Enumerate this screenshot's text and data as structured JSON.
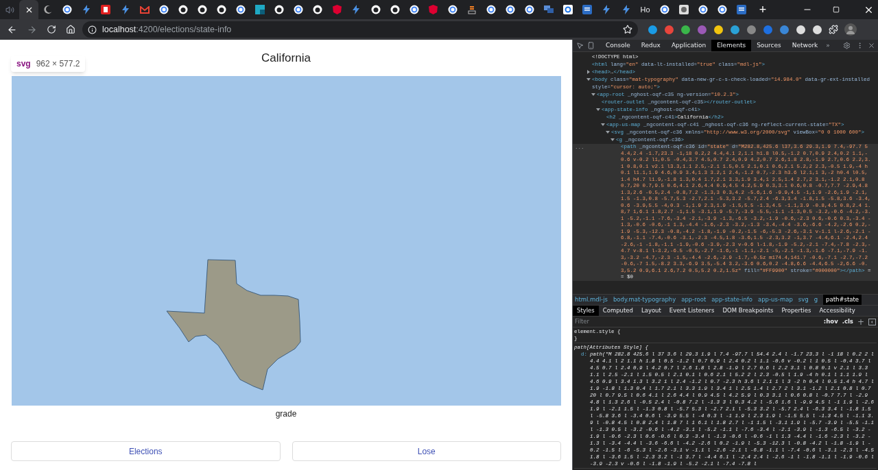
{
  "browser": {
    "tabs": [
      {
        "selected": false
      },
      {
        "selected": true
      },
      {
        "selected": false
      },
      {
        "selected": false
      },
      {
        "selected": false
      },
      {
        "selected": false
      },
      {
        "selected": false
      },
      {
        "selected": false
      },
      {
        "selected": false
      },
      {
        "selected": false
      },
      {
        "selected": false
      },
      {
        "selected": false
      },
      {
        "selected": false
      },
      {
        "selected": false
      },
      {
        "selected": false
      },
      {
        "selected": false
      },
      {
        "selected": false
      },
      {
        "selected": false
      },
      {
        "selected": false
      },
      {
        "selected": false
      },
      {
        "selected": false
      },
      {
        "selected": false
      },
      {
        "selected": false
      },
      {
        "selected": false
      },
      {
        "selected": false
      },
      {
        "selected": false
      },
      {
        "selected": false
      },
      {
        "selected": false
      },
      {
        "selected": false
      },
      {
        "selected": false
      },
      {
        "selected": false
      },
      {
        "selected": false
      },
      {
        "selected": false
      },
      {
        "selected": false,
        "label": "Ho"
      },
      {
        "selected": false
      },
      {
        "selected": false
      },
      {
        "selected": false
      },
      {
        "selected": false
      },
      {
        "selected": false
      }
    ],
    "new_tab": "+",
    "address": {
      "host": "localhost",
      "path": ":4200/elections/state-info"
    }
  },
  "page": {
    "title": "California",
    "tooltip": {
      "tag": "svg",
      "size": "962 × 577.2"
    },
    "caption": "grade",
    "buttons": [
      "Elections",
      "Lose"
    ]
  },
  "devtools": {
    "tabs": [
      {
        "label": "Console",
        "selected": false
      },
      {
        "label": "Redux",
        "selected": false
      },
      {
        "label": "Application",
        "selected": false
      },
      {
        "label": "Elements",
        "selected": true
      },
      {
        "label": "Sources",
        "selected": false
      },
      {
        "label": "Network",
        "selected": false
      }
    ],
    "more": "»",
    "dom": [
      {
        "selected": false,
        "parts": [
          {
            "kind": "text",
            "text": "<!DOCTYPE html>"
          }
        ]
      },
      {
        "selected": false,
        "parts": [
          {
            "kind": "tag",
            "text": "<html"
          },
          {
            "kind": "attr",
            "text": " lang="
          },
          {
            "kind": "val",
            "text": "\"en\""
          },
          {
            "kind": "attr",
            "text": " data-lt-installed="
          },
          {
            "kind": "val",
            "text": "\"true\""
          },
          {
            "kind": "attr",
            "text": " class="
          },
          {
            "kind": "val",
            "text": "\"mdl-js\""
          },
          {
            "kind": "tag",
            "text": ">"
          }
        ]
      },
      {
        "expanded": false,
        "selected": false,
        "parts": [
          {
            "kind": "tag",
            "text": "<head>"
          },
          {
            "kind": "text",
            "text": "…"
          },
          {
            "kind": "tag",
            "text": "</head>"
          }
        ]
      },
      {
        "expanded": true,
        "selected": false,
        "parts": [
          {
            "kind": "tag",
            "text": "<body"
          },
          {
            "kind": "attr",
            "text": " class="
          },
          {
            "kind": "val",
            "text": "\"mat-typography\""
          },
          {
            "kind": "attr",
            "text": " data-new-gr-c-s-check-loaded="
          },
          {
            "kind": "val",
            "text": "\"14.984.0\""
          },
          {
            "kind": "attr",
            "text": " data-gr-ext-installed style="
          },
          {
            "kind": "val",
            "text": "\"cursor: auto;\""
          },
          {
            "kind": "tag",
            "text": ">"
          }
        ],
        "children": [
          {
            "expanded": true,
            "selected": false,
            "parts": [
              {
                "kind": "tag",
                "text": "<app-root"
              },
              {
                "kind": "attr",
                "text": " _nghost-oqf-c35 ng-version="
              },
              {
                "kind": "val",
                "text": "\"10.2.3\""
              },
              {
                "kind": "tag",
                "text": ">"
              }
            ],
            "children": [
              {
                "selected": false,
                "parts": [
                  {
                    "kind": "tag",
                    "text": "<router-outlet"
                  },
                  {
                    "kind": "attr",
                    "text": " _ngcontent-oqf-c35"
                  },
                  {
                    "kind": "tag",
                    "text": "></router-outlet>"
                  }
                ]
              },
              {
                "expanded": true,
                "selected": false,
                "parts": [
                  {
                    "kind": "tag",
                    "text": "<app-state-info"
                  },
                  {
                    "kind": "attr",
                    "text": " _nghost-oqf-c41"
                  },
                  {
                    "kind": "tag",
                    "text": ">"
                  }
                ],
                "children": [
                  {
                    "selected": false,
                    "parts": [
                      {
                        "kind": "tag",
                        "text": "<h2"
                      },
                      {
                        "kind": "attr",
                        "text": " _ngcontent-oqf-c41"
                      },
                      {
                        "kind": "tag",
                        "text": ">"
                      },
                      {
                        "kind": "text",
                        "text": "California"
                      },
                      {
                        "kind": "tag",
                        "text": "</h2>"
                      }
                    ]
                  },
                  {
                    "expanded": true,
                    "selected": false,
                    "parts": [
                      {
                        "kind": "tag",
                        "text": "<app-us-map"
                      },
                      {
                        "kind": "attr",
                        "text": " _ngcontent-oqf-c41 _nghost-oqf-c36 ng-reflect-current-state="
                      },
                      {
                        "kind": "val",
                        "text": "\"TX\""
                      },
                      {
                        "kind": "tag",
                        "text": ">"
                      }
                    ],
                    "children": [
                      {
                        "expanded": true,
                        "selected": false,
                        "parts": [
                          {
                            "kind": "tag",
                            "text": "<svg"
                          },
                          {
                            "kind": "attr",
                            "text": " _ngcontent-oqf-c36 xmlns="
                          },
                          {
                            "kind": "val",
                            "text": "\"http://www.w3.org/2000/svg\""
                          },
                          {
                            "kind": "attr",
                            "text": " viewBox="
                          },
                          {
                            "kind": "val",
                            "text": "\"0 0 1000 600\""
                          },
                          {
                            "kind": "tag",
                            "text": ">"
                          }
                        ],
                        "children": [
                          {
                            "expanded": true,
                            "selected": false,
                            "parts": [
                              {
                                "kind": "tag",
                                "text": "<g"
                              },
                              {
                                "kind": "attr",
                                "text": " _ngcontent-oqf-c36"
                              },
                              {
                                "kind": "tag",
                                "text": ">"
                              }
                            ],
                            "children": [
                              {
                                "selected": true,
                                "gutter": "...",
                                "parts": [
                                  {
                                    "kind": "tag",
                                    "text": "<path"
                                  },
                                  {
                                    "kind": "attr",
                                    "text": " _ngcontent-oqf-c36 id="
                                  },
                                  {
                                    "kind": "val",
                                    "text": "\"state\""
                                  },
                                  {
                                    "kind": "attr",
                                    "text": " d="
                                  },
                                  {
                                    "kind": "val",
                                    "text": "\"M282.8,425.6 l37,3.6 29.3,1.9 7.4,-97.7 54.4,2.4 -1.7,23.3 -1,18 0.2,2 4.4,4.1 2,1.1 h1.8 l0.5,-1.2 0.7,0.9 2.4,0.2 1.1,-0.6 v-0.2 l1,0.5 -0.4,3.7 4.5,0.7 2.4,0.9 4.2,0.7 2.6,1.8 2.8,-1.9 2.7,0.6 2.2,3.1 0.8,0.1 v2.1 l3.3,1.1 2.5,-2.1 1.5,0.5 2.1,0.1 0.6,2.1 5.2,2 2.3,-0.5 1.9,-4 h0.1 l1.1,1.9 4.6,0.9 3.4,1.3 3.2,1 2.4,-1.2 0.7,-2.3 h3.6 l2.1,1 3,-2 h0.4 l0.5,1.4 h4.7 l1.9,-1.8 1.3,0.4 1.7,2.1 3.3,1.9 3.4,1 2.5,1.4 2.7,2 3.1,-1.2 2.1,0.8 0.7,20 0.7,9.5 0.6,4.1 2.6,4.4 0.9,4.5 4.2,5.9 0.3,3.1 0.6,0.8 -0.7,7.7 -2.9,4.8 1.3,2.6 -0.5,2.4 -0.8,7.2 -1.3,3 0.3,4.2 -5.6,1.6 -9.9,4.5 -1,1.9 -2.6,1.9 -2.1,1.5 -1.3,0.8 -5.7,5.3 -2.7,2.1 -5.3,3.2 -5.7,2.4 -6.3,3.4 -1.8,1.5 -5.8,3.6 -3.4,0.6 -3.9,5.5 -4,0.3 -1,1.9 2.3,1.9 -1.5,5.5 -1.3,4.5 -1.1,3.9 -0.8,4.5 0.8,2.4 1.8,7 1,6.1 1.8,2.7 -1,1.5 -3.1,1.9 -5.7,-3.9 -5.5,-1.1 -1.3,0.5 -3.2,-0.6 -4.2,-3.1 -5.2,-1.1 -7.6,-3.4 -2.1,-3.9 -1.3,-6.5 -3.2,-1.9 -0.6,-2.3 0.6,-0.6 0.3,-3.4 -1.3,-0.6 -0.6,-1 1.3,-4.4 -1.6,-2.3 -3.2,-1.3 -3.4,-4.4 -3.6,-6.6 -4.2,-2.6 0.2,-1.9 -5.3,-12.3 -0.8,-4.2 -1.8,-1.9 -0.2,-1.5 -6,-5.3 -2.6,-3.1 v-1.1 l-2.6,-2.1 -6.8,-1.1 -7.4,-0.6 -3.1,-2.3 -4.5,1.8 -3.6,1.5 -2.3,3.2 -1,3.7 -4.4,6.1 -2.4,2.4 -2.6,-1 -1.8,-1.1 -1.9,-0.6 -3.9,-2.3 v-0.6 l-1.8,-1.9 -5.2,-2.1 -7.4,-7.8 -2.3,-4.7 v-8.1 l-3.2,-6.5 -0.5,-2.7 -1.6,-1 -1.1,-2.1 -5,-2.1 -1.3,-1.6 -7.1,-7.9 -1.3,-3.2 -4.7,-2.3 -1.5,-4.4 -2.6,-2.9 -1.7,-0.5z m174.4,141.7 -0.6,-7.1 -2.7,-7.2 -0.6,-7 1.5,-8.2 3.3,-6.9 3.5,-5.4 3.2,-3.6 0.6,0.2 -4.8,6.6 -4.4,6.5 -2,6.6 -0.3,5.2 0.9,6.1 2.6,7.2 0.5,5.2 0.2,1.5z\""
                                  },
                                  {
                                    "kind": "attr",
                                    "text": " fill="
                                  },
                                  {
                                    "kind": "val",
                                    "text": "\"#FF9900\""
                                  },
                                  {
                                    "kind": "attr",
                                    "text": " stroke="
                                  },
                                  {
                                    "kind": "val",
                                    "text": "\"#000000\""
                                  },
                                  {
                                    "kind": "tag",
                                    "text": "></path>"
                                  },
                                  {
                                    "kind": "text",
                                    "text": " == $0"
                                  }
                                ]
                              }
                            ]
                          }
                        ]
                      }
                    ]
                  }
                ]
              }
            ]
          }
        ]
      }
    ],
    "breadcrumbs": [
      {
        "label": "html.mdl-js",
        "selected": false
      },
      {
        "label": "body.mat-typography",
        "selected": false
      },
      {
        "label": "app-root",
        "selected": false
      },
      {
        "label": "app-state-info",
        "selected": false
      },
      {
        "label": "app-us-map",
        "selected": false
      },
      {
        "label": "svg",
        "selected": false
      },
      {
        "label": "g",
        "selected": false
      },
      {
        "label": "path#state",
        "selected": true
      }
    ],
    "style_tabs": [
      {
        "label": "Styles",
        "selected": true
      },
      {
        "label": "Computed",
        "selected": false
      },
      {
        "label": "Layout",
        "selected": false
      },
      {
        "label": "Event Listeners",
        "selected": false
      },
      {
        "label": "DOM Breakpoints",
        "selected": false
      },
      {
        "label": "Properties",
        "selected": false
      },
      {
        "label": "Accessibility",
        "selected": false
      }
    ],
    "filter": {
      "placeholder": "Filter",
      "hov": ":hov",
      "cls": ".cls",
      "add": "+"
    },
    "rules": [
      {
        "selector": "element.style {",
        "close": "}"
      },
      {
        "selector": "path[Attributes Style] {",
        "property": "d:",
        "value": "path(\"M 282.8 425.6 l 37 3.6 l 29.3 1.9 l 7.4 -97.7 l 54.4 2.4 l -1.7 23.3 l -1 18 l 0.2 2 l 4.4 4.1 l 2 1.1 h 1.8 l 0.5 -1.2 l 0.7 0.9 l 2.4 0.2 l 1.1 -0.6 v -0.2 l 1 0.5 l -0.4 3.7 l 4.5 0.7 l 2.4 0.9 l 4.2 0.7 l 2.6 1.8 l 2.8 -1.9 l 2.7 0.6 l 2.2 3.1 l 0.8 0.1 v 2.1 l 3.3 1.1 l 2.5 -2.1 l 1.5 0.5 l 2.1 0.1 l 0.6 2.1 l 5.2 2 l 2.3 -0.5 l 1.9 -4 h 0.1 l 1.1 1.9 l 4.6 0.9 l 3.4 1.3 l 3.2 1 l 2.4 -1.2 l 0.7 -2.3 h 3.6 l 2.1 1 l 3 -2 h 0.4 l 0.5 1.4 h 4.7 l 1.9 -1.8 l 1.3 0.4 l 1.7 2.1 l 3.3 1.9 l 3.4 1 l 2.5 1.4 l 2.7 2 l 3.1 -1.2 l 2.1 0.8 l 0.7 20 l 0.7 9.5 l 0.6 4.1 l 2.6 4.4 l 0.9 4.5 l 4.2 5.9 l 0.3 3.1 l 0.6 0.8 l -0.7 7.7 l -2.9 4.8 l 1.3 2.6 l -0.5 2.4 l -0.8 7.2 l -1.3 3 l 0.3 4.2 l -5.6 1.6 l -9.9 4.5 l -1 1.9 l -2.6 1.9 l -2.1 1.5 l -1.3 0.8 l -5.7 5.3 l -2.7 2.1 l -5.3 3.2 l -5.7 2.4 l -6.3 3.4 l -1.8 1.5 l -5.8 3.6 l -3.4 0.6 l -3.9 5.5 l -4 0.3 l -1 1.9 l 2.3 1.9 l -1.5 5.5 l -1.3 4.5 l -1.1 3.9 l -0.8 4.5 l 0.8 2.4 l 1.8 7 l 1 6.1 l 1.8 2.7 l -1 1.5 l -3.1 1.9 l -5.7 -3.9 l -5.5 -1.1 l -1.3 0.5 l -3.2 -0.6 l -4.2 -3.1 l -5.2 -1.1 l -7.6 -3.4 l -2.1 -3.9 l -1.3 -6.5 l -3.2 -1.9 l -0.6 -2.3 l 0.6 -0.6 l 0.3 -3.4 l -1.3 -0.6 l -0.6 -1 l 1.3 -4.4 l -1.6 -2.3 l -3.2 -1.3 l -3.4 -4.4 l -3.6 -6.6 l -4.2 -2.6 l 0.2 -1.9 l -5.3 -12.3 l -0.8 -4.2 l -1.8 -1.9 l -0.2 -1.5 l -6 -5.3 l -2.6 -3.1 v -1.1 l -2.6 -2.1 l -6.8 -1.1 l -7.4 -0.6 l -3.1 -2.3 l -4.5 1.8 l -3.6 1.5 l -2.3 3.2 l -1 3.7 l -4.4 6.1 l -2.4 2.4 l -2.6 -1 l -1.8 -1.1 l -1.9 -0.6 l -3.9 -2.3 v -0.6 l -1.8 -1.9 l -5.2 -2.1 l -7.4 -7.8 l"
      }
    ]
  }
}
